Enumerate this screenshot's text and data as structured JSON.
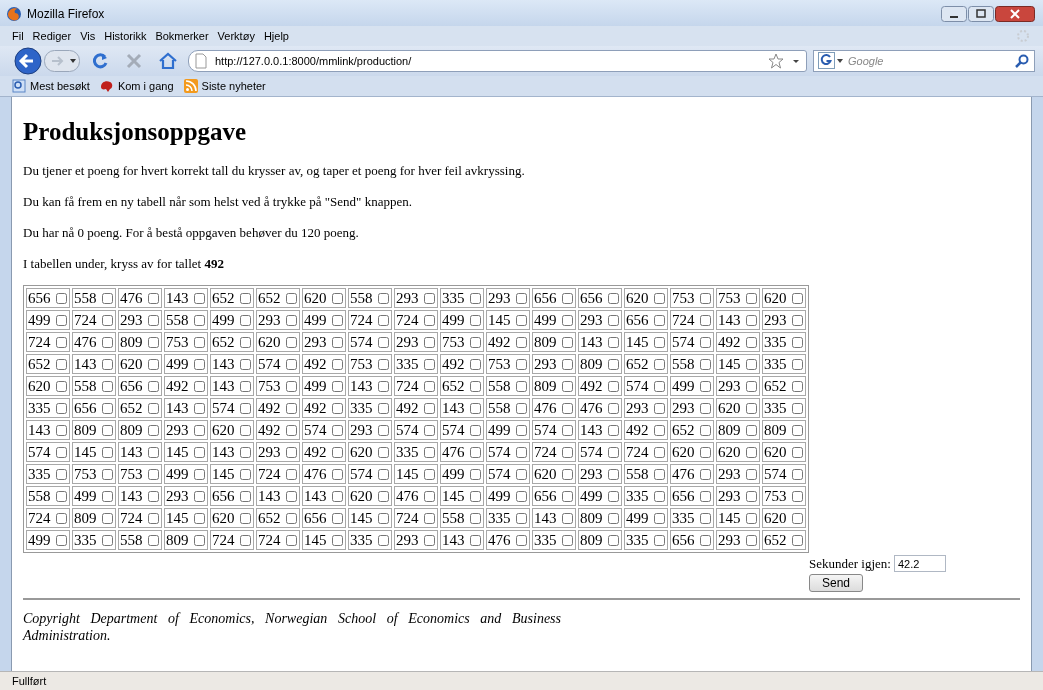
{
  "window": {
    "title": "Mozilla Firefox"
  },
  "menu": [
    "Fil",
    "Rediger",
    "Vis",
    "Historikk",
    "Bokmerker",
    "Verktøy",
    "Hjelp"
  ],
  "address": {
    "value": "http://127.0.0.1:8000/mmlink/production/"
  },
  "search": {
    "placeholder": "Google"
  },
  "bookmarks": [
    "Mest besøkt",
    "Kom i gang",
    "Siste nyheter"
  ],
  "page": {
    "heading": "Produksjonsoppgave",
    "paragraphs": [
      "Du tjener et poeng for hvert korrekt tall du krysser av, og taper et poeng for hver feil avkryssing.",
      "Du kan få frem en ny tabell når som helst ved å trykke på \"Send\" knappen.",
      "Du har nå 0 poeng. For å bestå oppgaven behøver du 120 poeng.",
      "I tabellen under, kryss av for tallet **492**"
    ],
    "rows": [
      [
        {
          "value": "656",
          "checked": false
        },
        {
          "value": "558",
          "checked": false
        },
        {
          "value": "476",
          "checked": false
        },
        {
          "value": "143",
          "checked": false
        },
        {
          "value": "652",
          "checked": false
        },
        {
          "value": "652",
          "checked": false
        },
        {
          "value": "620",
          "checked": false
        },
        {
          "value": "558",
          "checked": false
        },
        {
          "value": "293",
          "checked": false
        },
        {
          "value": "335",
          "checked": false
        },
        {
          "value": "293",
          "checked": false
        },
        {
          "value": "656",
          "checked": false
        },
        {
          "value": "656",
          "checked": false
        },
        {
          "value": "620",
          "checked": false
        },
        {
          "value": "753",
          "checked": false
        },
        {
          "value": "753",
          "checked": false
        },
        {
          "value": "620",
          "checked": false
        }
      ],
      [
        {
          "value": "499",
          "checked": false
        },
        {
          "value": "724",
          "checked": false
        },
        {
          "value": "293",
          "checked": false
        },
        {
          "value": "558",
          "checked": false
        },
        {
          "value": "499",
          "checked": false
        },
        {
          "value": "293",
          "checked": false
        },
        {
          "value": "499",
          "checked": false
        },
        {
          "value": "724",
          "checked": false
        },
        {
          "value": "724",
          "checked": false
        },
        {
          "value": "499",
          "checked": false
        },
        {
          "value": "145",
          "checked": false
        },
        {
          "value": "499",
          "checked": false
        },
        {
          "value": "293",
          "checked": false
        },
        {
          "value": "656",
          "checked": false
        },
        {
          "value": "724",
          "checked": false
        },
        {
          "value": "143",
          "checked": false
        },
        {
          "value": "293",
          "checked": false
        }
      ],
      [
        {
          "value": "724",
          "checked": false
        },
        {
          "value": "476",
          "checked": false
        },
        {
          "value": "809",
          "checked": false
        },
        {
          "value": "753",
          "checked": false
        },
        {
          "value": "652",
          "checked": false
        },
        {
          "value": "620",
          "checked": false
        },
        {
          "value": "293",
          "checked": false
        },
        {
          "value": "574",
          "checked": false
        },
        {
          "value": "293",
          "checked": false
        },
        {
          "value": "753",
          "checked": false
        },
        {
          "value": "492",
          "checked": false
        },
        {
          "value": "809",
          "checked": false
        },
        {
          "value": "143",
          "checked": false
        },
        {
          "value": "145",
          "checked": false
        },
        {
          "value": "574",
          "checked": false
        },
        {
          "value": "492",
          "checked": false
        },
        {
          "value": "335",
          "checked": false
        }
      ],
      [
        {
          "value": "652",
          "checked": false
        },
        {
          "value": "143",
          "checked": false
        },
        {
          "value": "620",
          "checked": false
        },
        {
          "value": "499",
          "checked": false
        },
        {
          "value": "143",
          "checked": false
        },
        {
          "value": "574",
          "checked": false
        },
        {
          "value": "492",
          "checked": false
        },
        {
          "value": "753",
          "checked": false
        },
        {
          "value": "335",
          "checked": false
        },
        {
          "value": "492",
          "checked": false
        },
        {
          "value": "753",
          "checked": false
        },
        {
          "value": "293",
          "checked": false
        },
        {
          "value": "809",
          "checked": false
        },
        {
          "value": "652",
          "checked": false
        },
        {
          "value": "558",
          "checked": false
        },
        {
          "value": "145",
          "checked": false
        },
        {
          "value": "335",
          "checked": false
        }
      ],
      [
        {
          "value": "620",
          "checked": false
        },
        {
          "value": "558",
          "checked": false
        },
        {
          "value": "656",
          "checked": false
        },
        {
          "value": "492",
          "checked": false
        },
        {
          "value": "143",
          "checked": false
        },
        {
          "value": "753",
          "checked": false
        },
        {
          "value": "499",
          "checked": false
        },
        {
          "value": "143",
          "checked": false
        },
        {
          "value": "724",
          "checked": false
        },
        {
          "value": "652",
          "checked": false
        },
        {
          "value": "558",
          "checked": false
        },
        {
          "value": "809",
          "checked": false
        },
        {
          "value": "492",
          "checked": false
        },
        {
          "value": "574",
          "checked": false
        },
        {
          "value": "499",
          "checked": false
        },
        {
          "value": "293",
          "checked": false
        },
        {
          "value": "652",
          "checked": false
        }
      ],
      [
        {
          "value": "335",
          "checked": false
        },
        {
          "value": "656",
          "checked": false
        },
        {
          "value": "652",
          "checked": false
        },
        {
          "value": "143",
          "checked": false
        },
        {
          "value": "574",
          "checked": false
        },
        {
          "value": "492",
          "checked": false
        },
        {
          "value": "492",
          "checked": false
        },
        {
          "value": "335",
          "checked": false
        },
        {
          "value": "492",
          "checked": false
        },
        {
          "value": "143",
          "checked": false
        },
        {
          "value": "558",
          "checked": false
        },
        {
          "value": "476",
          "checked": false
        },
        {
          "value": "476",
          "checked": false
        },
        {
          "value": "293",
          "checked": false
        },
        {
          "value": "293",
          "checked": false
        },
        {
          "value": "620",
          "checked": false
        },
        {
          "value": "335",
          "checked": false
        }
      ],
      [
        {
          "value": "143",
          "checked": false
        },
        {
          "value": "809",
          "checked": false
        },
        {
          "value": "809",
          "checked": false
        },
        {
          "value": "293",
          "checked": false
        },
        {
          "value": "620",
          "checked": false
        },
        {
          "value": "492",
          "checked": false
        },
        {
          "value": "574",
          "checked": false
        },
        {
          "value": "293",
          "checked": false
        },
        {
          "value": "574",
          "checked": false
        },
        {
          "value": "574",
          "checked": false
        },
        {
          "value": "499",
          "checked": false
        },
        {
          "value": "574",
          "checked": false
        },
        {
          "value": "143",
          "checked": false
        },
        {
          "value": "492",
          "checked": false
        },
        {
          "value": "652",
          "checked": false
        },
        {
          "value": "809",
          "checked": false
        },
        {
          "value": "809",
          "checked": false
        }
      ],
      [
        {
          "value": "574",
          "checked": false
        },
        {
          "value": "145",
          "checked": false
        },
        {
          "value": "143",
          "checked": false
        },
        {
          "value": "145",
          "checked": false
        },
        {
          "value": "143",
          "checked": false
        },
        {
          "value": "293",
          "checked": false
        },
        {
          "value": "492",
          "checked": false
        },
        {
          "value": "620",
          "checked": false
        },
        {
          "value": "335",
          "checked": false
        },
        {
          "value": "476",
          "checked": false
        },
        {
          "value": "574",
          "checked": false
        },
        {
          "value": "724",
          "checked": false
        },
        {
          "value": "574",
          "checked": false
        },
        {
          "value": "724",
          "checked": false
        },
        {
          "value": "620",
          "checked": false
        },
        {
          "value": "620",
          "checked": false
        },
        {
          "value": "620",
          "checked": false
        }
      ],
      [
        {
          "value": "335",
          "checked": false
        },
        {
          "value": "753",
          "checked": false
        },
        {
          "value": "753",
          "checked": false
        },
        {
          "value": "499",
          "checked": false
        },
        {
          "value": "145",
          "checked": false
        },
        {
          "value": "724",
          "checked": false
        },
        {
          "value": "476",
          "checked": false
        },
        {
          "value": "574",
          "checked": false
        },
        {
          "value": "145",
          "checked": false
        },
        {
          "value": "499",
          "checked": false
        },
        {
          "value": "574",
          "checked": false
        },
        {
          "value": "620",
          "checked": false
        },
        {
          "value": "293",
          "checked": false
        },
        {
          "value": "558",
          "checked": false
        },
        {
          "value": "476",
          "checked": false
        },
        {
          "value": "293",
          "checked": false
        },
        {
          "value": "574",
          "checked": false
        }
      ],
      [
        {
          "value": "558",
          "checked": false
        },
        {
          "value": "499",
          "checked": false
        },
        {
          "value": "143",
          "checked": false
        },
        {
          "value": "293",
          "checked": false
        },
        {
          "value": "656",
          "checked": false
        },
        {
          "value": "143",
          "checked": false
        },
        {
          "value": "143",
          "checked": false
        },
        {
          "value": "620",
          "checked": false
        },
        {
          "value": "476",
          "checked": false
        },
        {
          "value": "145",
          "checked": false
        },
        {
          "value": "499",
          "checked": false
        },
        {
          "value": "656",
          "checked": false
        },
        {
          "value": "499",
          "checked": false
        },
        {
          "value": "335",
          "checked": false
        },
        {
          "value": "656",
          "checked": false
        },
        {
          "value": "293",
          "checked": false
        },
        {
          "value": "753",
          "checked": false
        }
      ],
      [
        {
          "value": "724",
          "checked": false
        },
        {
          "value": "809",
          "checked": false
        },
        {
          "value": "724",
          "checked": false
        },
        {
          "value": "145",
          "checked": false
        },
        {
          "value": "620",
          "checked": false
        },
        {
          "value": "652",
          "checked": false
        },
        {
          "value": "656",
          "checked": false
        },
        {
          "value": "145",
          "checked": false
        },
        {
          "value": "724",
          "checked": false
        },
        {
          "value": "558",
          "checked": false
        },
        {
          "value": "335",
          "checked": false
        },
        {
          "value": "143",
          "checked": false
        },
        {
          "value": "809",
          "checked": false
        },
        {
          "value": "499",
          "checked": false
        },
        {
          "value": "335",
          "checked": false
        },
        {
          "value": "145",
          "checked": false
        },
        {
          "value": "620",
          "checked": false
        }
      ],
      [
        {
          "value": "499",
          "checked": false
        },
        {
          "value": "335",
          "checked": false
        },
        {
          "value": "558",
          "checked": false
        },
        {
          "value": "809",
          "checked": false
        },
        {
          "value": "724",
          "checked": false
        },
        {
          "value": "724",
          "checked": false
        },
        {
          "value": "145",
          "checked": false
        },
        {
          "value": "335",
          "checked": false
        },
        {
          "value": "293",
          "checked": false
        },
        {
          "value": "143",
          "checked": false
        },
        {
          "value": "476",
          "checked": false
        },
        {
          "value": "335",
          "checked": false
        },
        {
          "value": "809",
          "checked": false
        },
        {
          "value": "335",
          "checked": false
        },
        {
          "value": "656",
          "checked": false
        },
        {
          "value": "293",
          "checked": false
        },
        {
          "value": "652",
          "checked": false
        }
      ]
    ],
    "timer_label": "Sekunder igjen:",
    "timer_value": "42.2",
    "send": "Send",
    "copyright": "Copyright Department of Economics, Norwegian School of Economics and Business Administration."
  },
  "status_bar": "Fullført"
}
